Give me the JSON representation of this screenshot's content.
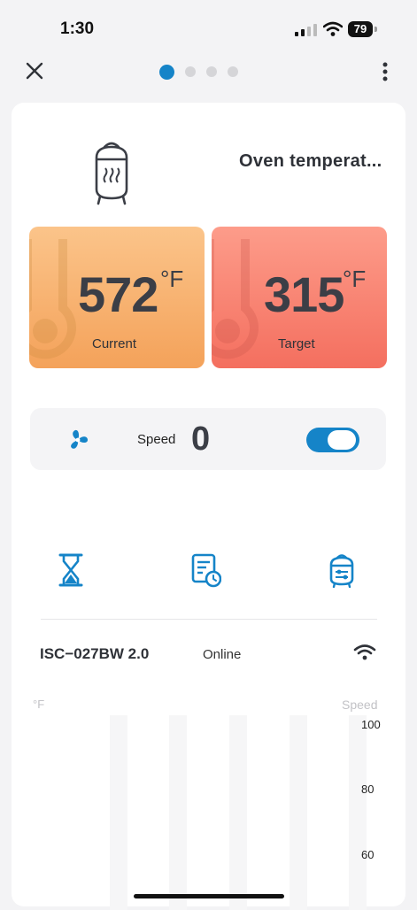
{
  "status": {
    "time": "1:30",
    "battery": "79"
  },
  "nav": {
    "page_count": 4,
    "active_page": 0
  },
  "oven": {
    "title": "Oven temperat..."
  },
  "temps": {
    "current": {
      "value": "572",
      "unit": "°F",
      "label": "Current"
    },
    "target": {
      "value": "315",
      "unit": "°F",
      "label": "Target"
    }
  },
  "fan": {
    "speed_label": "Speed",
    "speed_value": "0",
    "toggle_on": true
  },
  "device": {
    "name": "ISC−027BW 2.0",
    "status": "Online"
  },
  "chart": {
    "left_axis_label": "°F",
    "right_axis_label": "Speed",
    "right_ticks": [
      "100",
      "80",
      "60"
    ]
  },
  "colors": {
    "accent": "#1584c8",
    "current_tile": "#f6a862",
    "target_tile": "#f77d6c"
  },
  "icons": [
    "close-icon",
    "more-icon",
    "smoker-icon",
    "thermometer-icon",
    "fan-icon",
    "hourglass-icon",
    "schedule-icon",
    "smoker-settings-icon",
    "wifi-icon"
  ]
}
